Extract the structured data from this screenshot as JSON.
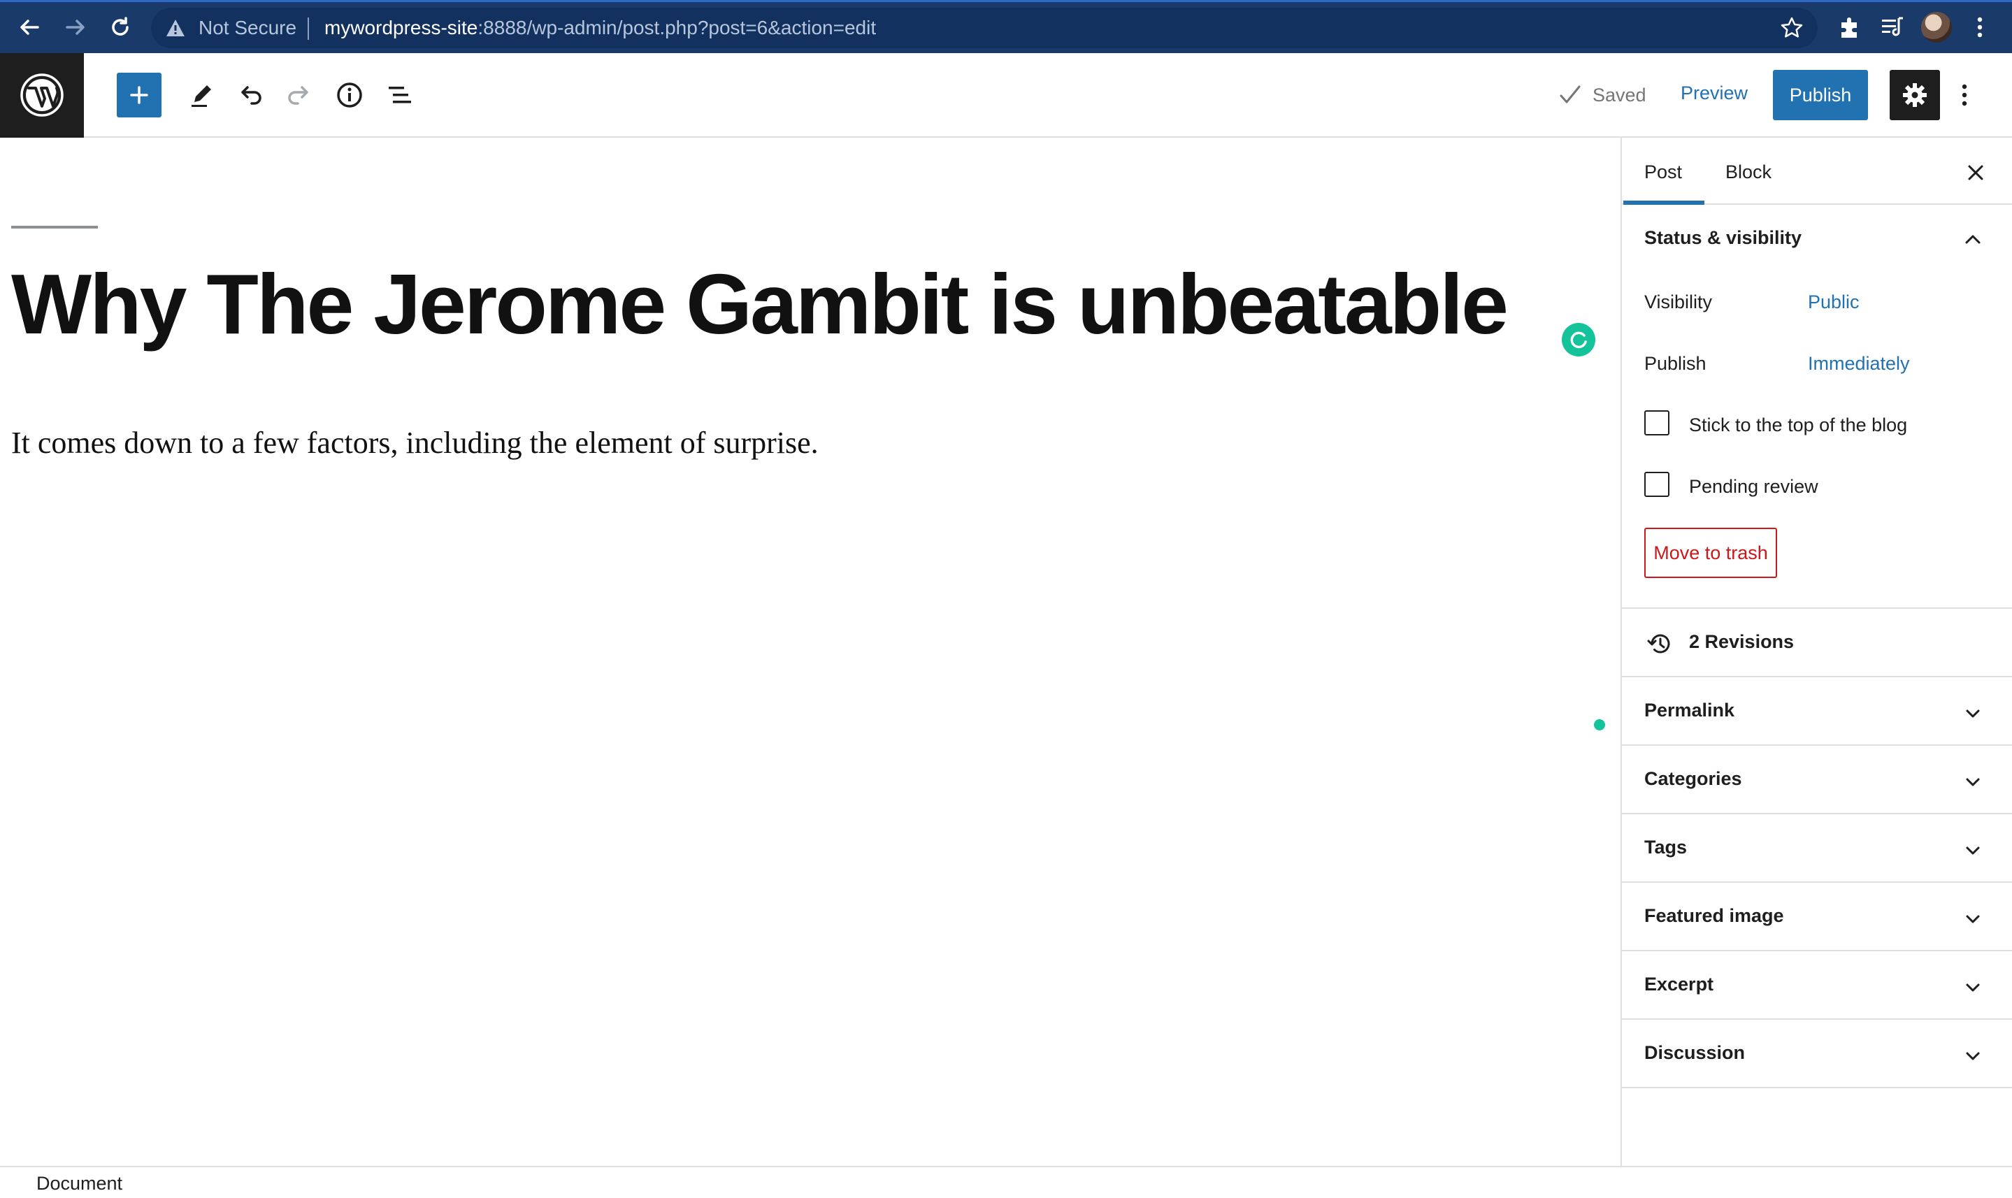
{
  "browser": {
    "security_label": "Not Secure",
    "url_host": "mywordpress-site",
    "url_path": ":8888/wp-admin/post.php?post=6&action=edit"
  },
  "toolbar": {
    "saved_label": "Saved",
    "preview_label": "Preview",
    "publish_label": "Publish"
  },
  "post": {
    "title": "Why The Jerome Gambit is unbeatable",
    "body": "It comes down to a few factors, including the element of surprise."
  },
  "sidebar": {
    "tabs": [
      {
        "label": "Post",
        "active": true
      },
      {
        "label": "Block",
        "active": false
      }
    ],
    "status": {
      "heading": "Status & visibility",
      "visibility_label": "Visibility",
      "visibility_value": "Public",
      "publish_label": "Publish",
      "publish_value": "Immediately",
      "sticky_label": "Stick to the top of the blog",
      "pending_label": "Pending review",
      "trash_label": "Move to trash"
    },
    "revisions_label": "2 Revisions",
    "panels": [
      {
        "label": "Permalink"
      },
      {
        "label": "Categories"
      },
      {
        "label": "Tags"
      },
      {
        "label": "Featured image"
      },
      {
        "label": "Excerpt"
      },
      {
        "label": "Discussion"
      }
    ]
  },
  "footer": {
    "breadcrumb": "Document"
  },
  "colors": {
    "accent": "#2271b1",
    "danger": "#cc1818",
    "grammarly": "#15c39a"
  }
}
